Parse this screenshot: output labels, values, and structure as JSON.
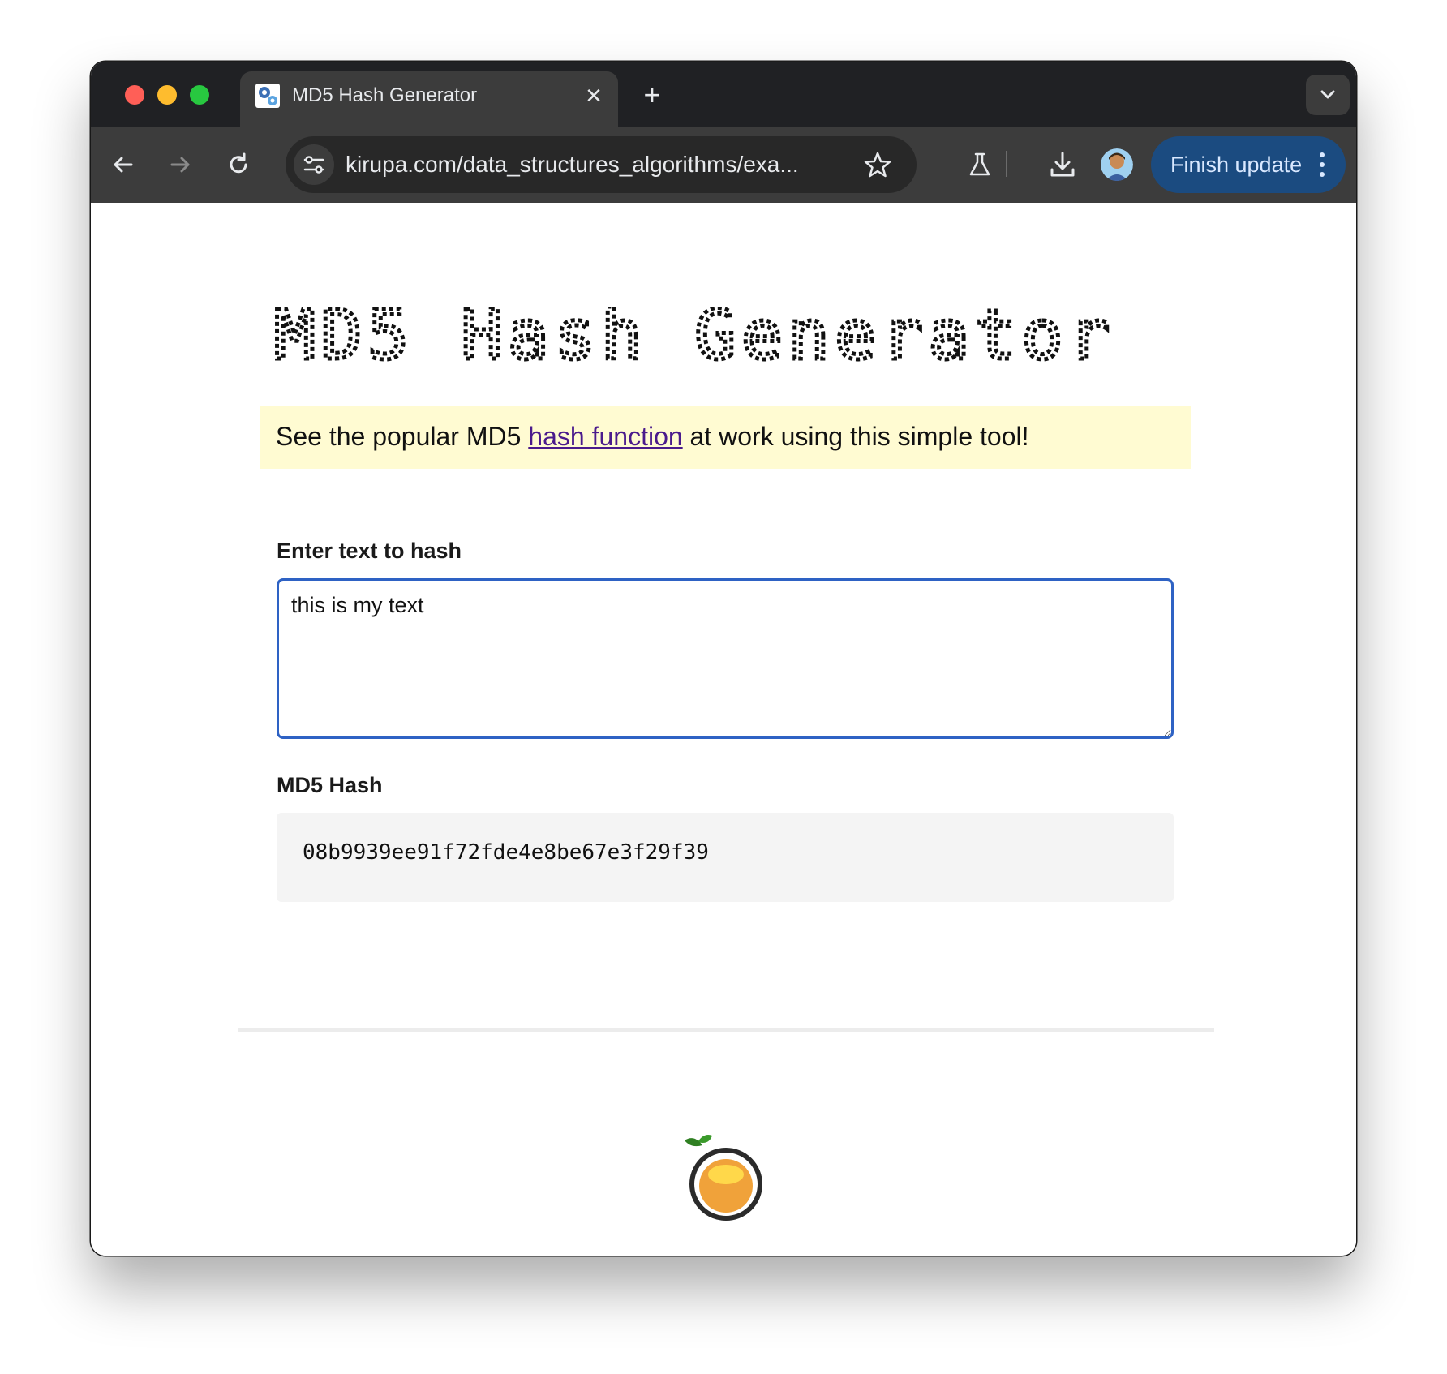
{
  "browser": {
    "tab": {
      "title": "MD5 Hash Generator",
      "favicon": "gears-favicon-icon"
    },
    "url": "kirupa.com/data_structures_algorithms/exa...",
    "finish_update_label": "Finish update",
    "icons": {
      "back": "arrow-left-icon",
      "forward": "arrow-right-icon",
      "reload": "reload-icon",
      "site_info": "tune-icon",
      "bookmark": "star-icon",
      "labs": "flask-icon",
      "download": "download-icon",
      "profile": "avatar",
      "menu": "kebab-icon",
      "new_tab": "plus-icon",
      "close_tab": "close-icon",
      "tab_search": "chevron-down-icon"
    }
  },
  "page": {
    "title": "MD5 Hash Generator",
    "intro": {
      "before": "See the popular MD5 ",
      "link": "hash function",
      "after": " at work using this simple tool!"
    },
    "input": {
      "label": "Enter text to hash",
      "value": "this is my text"
    },
    "output": {
      "label": "MD5 Hash",
      "value": "08b9939ee91f72fde4e8be67e3f29f39"
    }
  },
  "colors": {
    "intro_background": "#fffbd2",
    "link": "#4a1a8c",
    "input_border": "#2e62c4",
    "finish_update_bg": "#1b4b80",
    "logo_orange": "#f0a23a",
    "logo_leaf": "#3a9a2a"
  }
}
